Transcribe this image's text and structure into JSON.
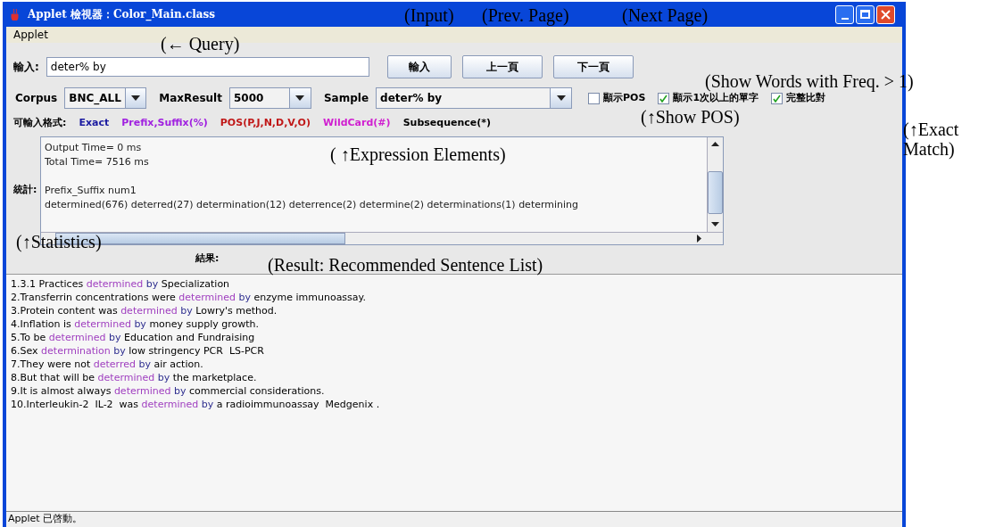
{
  "window": {
    "title": "Applet 檢視器：Color_Main.class"
  },
  "menu": [
    "Applet"
  ],
  "query": {
    "label": "輸入:",
    "value": "deter% by"
  },
  "buttons": [
    "輸入",
    "上一頁",
    "下一頁"
  ],
  "options": [
    {
      "label": "Corpus",
      "value": "BNC_ALL",
      "kind": "combo"
    },
    {
      "label": "MaxResult",
      "value": "5000",
      "kind": "combo"
    },
    {
      "label": "Sample",
      "value": "deter% by",
      "kind": "wide"
    }
  ],
  "checkboxes": [
    {
      "label": "顯示POS",
      "checked": false
    },
    {
      "label": "顯示1次以上的單字",
      "checked": true
    },
    {
      "label": "完整比對",
      "checked": true
    }
  ],
  "formats": {
    "label": "可輸入格式:",
    "items": [
      {
        "text": "Exact",
        "color": "#1a1aa0"
      },
      {
        "text": "Prefix,Suffix(%)",
        "color": "#a020e0"
      },
      {
        "text": "POS(P,J,N,D,V,O)",
        "color": "#c01818"
      },
      {
        "text": "WildCard(#)",
        "color": "#d020d0"
      },
      {
        "text": "Subsequence(*)",
        "color": "#000000"
      }
    ]
  },
  "statistics": {
    "label": "統計:",
    "timing": [
      "Output Time= 0 ms",
      "Total Time= 7516 ms"
    ],
    "details": [
      "Prefix_Suffix num1",
      "determined(676) deterred(27) determination(12) deterrence(2) determine(2) determinations(1) determining"
    ]
  },
  "result": {
    "label": "結果:"
  },
  "sentences": [
    [
      {
        "kind": "plain",
        "text": "1.3.1 Practices "
      },
      {
        "kind": "match",
        "text": "determined"
      },
      {
        "kind": "by",
        "text": " by"
      },
      {
        "kind": "plain",
        "text": " Specialization"
      }
    ],
    [
      {
        "kind": "plain",
        "text": "2.Transferrin concentrations were "
      },
      {
        "kind": "match",
        "text": "determined"
      },
      {
        "kind": "by",
        "text": " by"
      },
      {
        "kind": "plain",
        "text": " enzyme immunoassay."
      }
    ],
    [
      {
        "kind": "plain",
        "text": "3.Protein content was "
      },
      {
        "kind": "match",
        "text": "determined"
      },
      {
        "kind": "by",
        "text": " by"
      },
      {
        "kind": "plain",
        "text": " Lowry's method."
      }
    ],
    [
      {
        "kind": "plain",
        "text": "4.Inflation is "
      },
      {
        "kind": "match",
        "text": "determined"
      },
      {
        "kind": "by",
        "text": " by"
      },
      {
        "kind": "plain",
        "text": " money supply growth."
      }
    ],
    [
      {
        "kind": "plain",
        "text": "5.To be "
      },
      {
        "kind": "match",
        "text": "determined"
      },
      {
        "kind": "by",
        "text": " by"
      },
      {
        "kind": "plain",
        "text": " Education and Fundraising"
      }
    ],
    [
      {
        "kind": "plain",
        "text": "6.Sex "
      },
      {
        "kind": "match",
        "text": "determination"
      },
      {
        "kind": "by",
        "text": " by"
      },
      {
        "kind": "plain",
        "text": " low stringency PCR  LS-PCR"
      }
    ],
    [
      {
        "kind": "plain",
        "text": "7.They were not "
      },
      {
        "kind": "match",
        "text": "deterred"
      },
      {
        "kind": "by",
        "text": " by"
      },
      {
        "kind": "plain",
        "text": " air action."
      }
    ],
    [
      {
        "kind": "plain",
        "text": "8.But that will be "
      },
      {
        "kind": "match",
        "text": "determined"
      },
      {
        "kind": "by",
        "text": " by"
      },
      {
        "kind": "plain",
        "text": " the marketplace."
      }
    ],
    [
      {
        "kind": "plain",
        "text": "9.It is almost always "
      },
      {
        "kind": "match",
        "text": "determined"
      },
      {
        "kind": "by",
        "text": " by"
      },
      {
        "kind": "plain",
        "text": " commercial considerations."
      }
    ],
    [
      {
        "kind": "plain",
        "text": "10.Interleukin-2  IL-2  was "
      },
      {
        "kind": "match",
        "text": "determined"
      },
      {
        "kind": "by",
        "text": " by"
      },
      {
        "kind": "plain",
        "text": " a radioimmunoassay  Medgenix ."
      }
    ]
  ],
  "status_bar": "Applet 已啓動。",
  "annotations": [
    "(Input)",
    "(Prev. Page)",
    "(Next Page)",
    "(← Query)",
    "(Show Words with Freq. > 1)",
    "(↑Show POS)",
    "( ↑Expression Elements)",
    "(↑Exact Match)",
    "(↑Statistics)",
    "(Result: Recommended Sentence List)"
  ]
}
